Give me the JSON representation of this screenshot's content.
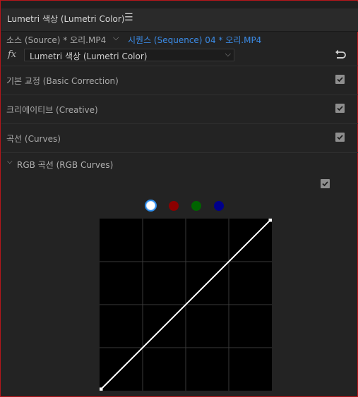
{
  "panel": {
    "title": "Lumetri 색상 (Lumetri Color)",
    "menu_icon": "hamburger-menu-icon"
  },
  "source_bar": {
    "source_label": "소스 (Source) * 오리.MP4",
    "sequence_label": "시퀀스 (Sequence) 04 * 오리.MP4"
  },
  "effect": {
    "fx_label": "fx",
    "selected_effect": "Lumetri 색상 (Lumetri Color)",
    "reset_icon": "reset-icon"
  },
  "sections": [
    {
      "label": "기본 교정 (Basic Correction)",
      "checked": true
    },
    {
      "label": "크리에이티브 (Creative)",
      "checked": true
    },
    {
      "label": "곡선 (Curves)",
      "checked": true
    }
  ],
  "rgb_curves": {
    "label": "RGB 곡선 (RGB Curves)",
    "checked": true,
    "channels": [
      {
        "name": "luma",
        "color": "#ffffff",
        "selected": true
      },
      {
        "name": "red",
        "color": "#8b0000",
        "selected": false
      },
      {
        "name": "green",
        "color": "#006400",
        "selected": false
      },
      {
        "name": "blue",
        "color": "#00008b",
        "selected": false
      }
    ],
    "curve_points": [
      [
        0,
        0
      ],
      [
        1,
        1
      ]
    ]
  },
  "colors": {
    "accent_blue": "#3b8be6",
    "frame_red": "#b5161b"
  }
}
